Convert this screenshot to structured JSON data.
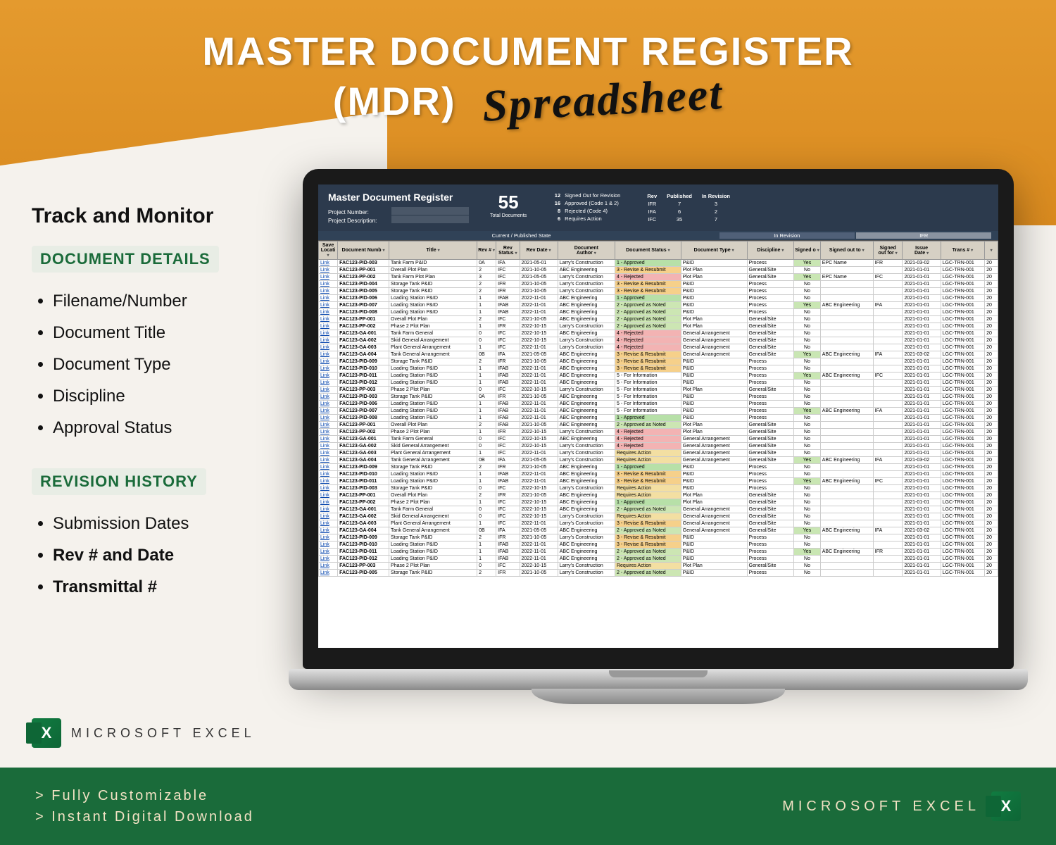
{
  "hero": {
    "line1": "MASTER DOCUMENT REGISTER",
    "line2": "(MDR)",
    "script": "Spreadsheet"
  },
  "sidebar": {
    "heading": "Track and Monitor",
    "section1": {
      "title": "DOCUMENT DETAILS",
      "items": [
        "Filename/Number",
        "Document Title",
        "Document Type",
        "Discipline",
        "Approval Status"
      ]
    },
    "section2": {
      "title": "REVISION HISTORY",
      "items": [
        "Submission Dates",
        "Rev # and Date",
        "Transmittal #"
      ],
      "bold": [
        1,
        2
      ]
    }
  },
  "excel_label": "MICROSOFT EXCEL",
  "footer": {
    "lines": [
      "> Fully Customizable",
      "> Instant Digital Download"
    ],
    "right": "MICROSOFT EXCEL"
  },
  "dash": {
    "title": "Master Document Register",
    "meta": [
      {
        "label": "Project Number:"
      },
      {
        "label": "Project Description:"
      }
    ],
    "total": {
      "value": "55",
      "sub": "Total\nDocuments"
    },
    "legend": [
      [
        "12",
        "Signed Out for Revision"
      ],
      [
        "16",
        "Approved (Code 1 & 2)"
      ],
      [
        "8",
        "Rejected (Code 4)"
      ],
      [
        "6",
        "Requires Action"
      ]
    ],
    "revtbl": {
      "cols": [
        "Rev",
        "Published",
        "In Revision"
      ],
      "rows": [
        [
          "IFR",
          "7",
          "3"
        ],
        [
          "IFA",
          "6",
          "2"
        ],
        [
          "IFC",
          "35",
          "7"
        ]
      ]
    }
  },
  "band_center": "Current / Published State",
  "band_right": [
    "In Revision",
    "IFR"
  ],
  "cols": [
    "Save\nLocati",
    "Document Numb",
    "Title",
    "Rev #",
    "Rev\nStatus",
    "Rev Date",
    "Document\nAuthor",
    "Document Status",
    "Document Type",
    "Discipline",
    "Signed o",
    "Signed out to",
    "Signed\nout for",
    "Issue\nDate",
    "Trans #",
    ""
  ],
  "status_class": {
    "1 - Approved": "st-approved",
    "2 - Approved as Noted": "st-appnoted",
    "3 - Revise & Resubmit": "st-resubmit",
    "4 - Rejected": "st-rejected",
    "5 - For Information": "st-info",
    "Requires Action": "st-action"
  },
  "rows": [
    [
      "Link",
      "FAC123-PID-003",
      "Tank Farm P&ID",
      "0A",
      "IFA",
      "2021-05-01",
      "Larry's Construction",
      "1 - Approved",
      "P&ID",
      "Process",
      "Yes",
      "EPC Name",
      "IFR",
      "2021-03-02",
      "LGC-TRN-001",
      "20"
    ],
    [
      "Link",
      "FAC123-PP-001",
      "Overall Plot Plan",
      "2",
      "IFC",
      "2021-10-05",
      "ABC Engineering",
      "3 - Revise & Resubmit",
      "Plot Plan",
      "General/Site",
      "No",
      "",
      "",
      "2021-01-01",
      "LGC-TRN-001",
      "20"
    ],
    [
      "Link",
      "FAC123-PP-002",
      "Tank Farm Plot Plan",
      "3",
      "IFC",
      "2021-05-05",
      "Larry's Construction",
      "4 - Rejected",
      "Plot Plan",
      "General/Site",
      "Yes",
      "EPC Name",
      "IFC",
      "2021-01-01",
      "LGC-TRN-001",
      "20"
    ],
    [
      "Link",
      "FAC123-PID-004",
      "Storage Tank P&ID",
      "2",
      "IFR",
      "2021-10-05",
      "Larry's Construction",
      "3 - Revise & Resubmit",
      "P&ID",
      "Process",
      "No",
      "",
      "",
      "2021-01-01",
      "LGC-TRN-001",
      "20"
    ],
    [
      "Link",
      "FAC123-PID-005",
      "Storage Tank P&ID",
      "2",
      "IFR",
      "2021-10-05",
      "Larry's Construction",
      "3 - Revise & Resubmit",
      "P&ID",
      "Process",
      "No",
      "",
      "",
      "2021-01-01",
      "LGC-TRN-001",
      "20"
    ],
    [
      "Link",
      "FAC123-PID-006",
      "Loading Station P&ID",
      "1",
      "IFAB",
      "2022-11-01",
      "ABC Engineering",
      "1 - Approved",
      "P&ID",
      "Process",
      "No",
      "",
      "",
      "2021-01-01",
      "LGC-TRN-001",
      "20"
    ],
    [
      "Link",
      "FAC123-PID-007",
      "Loading Station P&ID",
      "1",
      "IFAB",
      "2022-11-01",
      "ABC Engineering",
      "2 - Approved as Noted",
      "P&ID",
      "Process",
      "Yes",
      "ABC Engineering",
      "IFA",
      "2021-01-01",
      "LGC-TRN-001",
      "20"
    ],
    [
      "Link",
      "FAC123-PID-008",
      "Loading Station P&ID",
      "1",
      "IFAB",
      "2022-11-01",
      "ABC Engineering",
      "2 - Approved as Noted",
      "P&ID",
      "Process",
      "No",
      "",
      "",
      "2021-01-01",
      "LGC-TRN-001",
      "20"
    ],
    [
      "Link",
      "FAC123-PP-001",
      "Overall Plot Plan",
      "2",
      "IFC",
      "2021-10-05",
      "ABC Engineering",
      "2 - Approved as Noted",
      "Plot Plan",
      "General/Site",
      "No",
      "",
      "",
      "2021-01-01",
      "LGC-TRN-001",
      "20"
    ],
    [
      "Link",
      "FAC123-PP-002",
      "Phase 2 Plot Plan",
      "1",
      "IFR",
      "2022-10-15",
      "Larry's Construction",
      "2 - Approved as Noted",
      "Plot Plan",
      "General/Site",
      "No",
      "",
      "",
      "2021-01-01",
      "LGC-TRN-001",
      "20"
    ],
    [
      "Link",
      "FAC123-GA-001",
      "Tank Farm General",
      "0",
      "IFC",
      "2022-10-15",
      "ABC Engineering",
      "4 - Rejected",
      "General Arrangement",
      "General/Site",
      "No",
      "",
      "",
      "2021-01-01",
      "LGC-TRN-001",
      "20"
    ],
    [
      "Link",
      "FAC123-GA-002",
      "Skid General Arrangement",
      "0",
      "IFC",
      "2022-10-15",
      "Larry's Construction",
      "4 - Rejected",
      "General Arrangement",
      "General/Site",
      "No",
      "",
      "",
      "2021-01-01",
      "LGC-TRN-001",
      "20"
    ],
    [
      "Link",
      "FAC123-GA-003",
      "Plant General Arrangement",
      "1",
      "IFC",
      "2022-11-01",
      "Larry's Construction",
      "4 - Rejected",
      "General Arrangement",
      "General/Site",
      "No",
      "",
      "",
      "2021-01-01",
      "LGC-TRN-001",
      "20"
    ],
    [
      "Link",
      "FAC123-GA-004",
      "Tank General Arrangement",
      "0B",
      "IFA",
      "2021-05-05",
      "ABC Engineering",
      "3 - Revise & Resubmit",
      "General Arrangement",
      "General/Site",
      "Yes",
      "ABC Engineering",
      "IFA",
      "2021-03-02",
      "LGC-TRN-001",
      "20"
    ],
    [
      "Link",
      "FAC123-PID-009",
      "Storage Tank P&ID",
      "2",
      "IFR",
      "2021-10-05",
      "ABC Engineering",
      "3 - Revise & Resubmit",
      "P&ID",
      "Process",
      "No",
      "",
      "",
      "2021-01-01",
      "LGC-TRN-001",
      "20"
    ],
    [
      "Link",
      "FAC123-PID-010",
      "Loading Station P&ID",
      "1",
      "IFAB",
      "2022-11-01",
      "ABC Engineering",
      "3 - Revise & Resubmit",
      "P&ID",
      "Process",
      "No",
      "",
      "",
      "2021-01-01",
      "LGC-TRN-001",
      "20"
    ],
    [
      "Link",
      "FAC123-PID-011",
      "Loading Station P&ID",
      "1",
      "IFAB",
      "2022-11-01",
      "ABC Engineering",
      "5 - For Information",
      "P&ID",
      "Process",
      "Yes",
      "ABC Engineering",
      "IFC",
      "2021-01-01",
      "LGC-TRN-001",
      "20"
    ],
    [
      "Link",
      "FAC123-PID-012",
      "Loading Station P&ID",
      "1",
      "IFAB",
      "2022-11-01",
      "ABC Engineering",
      "5 - For Information",
      "P&ID",
      "Process",
      "No",
      "",
      "",
      "2021-01-01",
      "LGC-TRN-001",
      "20"
    ],
    [
      "Link",
      "FAC123-PP-003",
      "Phase 2 Plot Plan",
      "0",
      "IFC",
      "2022-10-15",
      "Larry's Construction",
      "5 - For Information",
      "Plot Plan",
      "General/Site",
      "No",
      "",
      "",
      "2021-01-01",
      "LGC-TRN-001",
      "20"
    ],
    [
      "Link",
      "FAC123-PID-003",
      "Storage Tank P&ID",
      "0A",
      "IFR",
      "2021-10-05",
      "ABC Engineering",
      "5 - For Information",
      "P&ID",
      "Process",
      "No",
      "",
      "",
      "2021-01-01",
      "LGC-TRN-001",
      "20"
    ],
    [
      "Link",
      "FAC123-PID-006",
      "Loading Station P&ID",
      "1",
      "IFAB",
      "2022-11-01",
      "ABC Engineering",
      "5 - For Information",
      "P&ID",
      "Process",
      "No",
      "",
      "",
      "2021-01-01",
      "LGC-TRN-001",
      "20"
    ],
    [
      "Link",
      "FAC123-PID-007",
      "Loading Station P&ID",
      "1",
      "IFAB",
      "2022-11-01",
      "ABC Engineering",
      "5 - For Information",
      "P&ID",
      "Process",
      "Yes",
      "ABC Engineering",
      "IFA",
      "2021-01-01",
      "LGC-TRN-001",
      "20"
    ],
    [
      "Link",
      "FAC123-PID-008",
      "Loading Station P&ID",
      "1",
      "IFAB",
      "2022-11-01",
      "ABC Engineering",
      "1 - Approved",
      "P&ID",
      "Process",
      "No",
      "",
      "",
      "2021-01-01",
      "LGC-TRN-001",
      "20"
    ],
    [
      "Link",
      "FAC123-PP-001",
      "Overall Plot Plan",
      "2",
      "IFAB",
      "2021-10-05",
      "ABC Engineering",
      "2 - Approved as Noted",
      "Plot Plan",
      "General/Site",
      "No",
      "",
      "",
      "2021-01-01",
      "LGC-TRN-001",
      "20"
    ],
    [
      "Link",
      "FAC123-PP-002",
      "Phase 2 Plot Plan",
      "1",
      "IFR",
      "2022-10-15",
      "Larry's Construction",
      "4 - Rejected",
      "Plot Plan",
      "General/Site",
      "No",
      "",
      "",
      "2021-01-01",
      "LGC-TRN-001",
      "20"
    ],
    [
      "Link",
      "FAC123-GA-001",
      "Tank Farm General",
      "0",
      "IFC",
      "2022-10-15",
      "ABC Engineering",
      "4 - Rejected",
      "General Arrangement",
      "General/Site",
      "No",
      "",
      "",
      "2021-01-01",
      "LGC-TRN-001",
      "20"
    ],
    [
      "Link",
      "FAC123-GA-002",
      "Skid General Arrangement",
      "0",
      "IFC",
      "2022-10-15",
      "Larry's Construction",
      "4 - Rejected",
      "General Arrangement",
      "General/Site",
      "No",
      "",
      "",
      "2021-01-01",
      "LGC-TRN-001",
      "20"
    ],
    [
      "Link",
      "FAC123-GA-003",
      "Plant General Arrangement",
      "1",
      "IFC",
      "2022-11-01",
      "Larry's Construction",
      "Requires Action",
      "General Arrangement",
      "General/Site",
      "No",
      "",
      "",
      "2021-01-01",
      "LGC-TRN-001",
      "20"
    ],
    [
      "Link",
      "FAC123-GA-004",
      "Tank General Arrangement",
      "0B",
      "IFA",
      "2021-05-05",
      "Larry's Construction",
      "Requires Action",
      "General Arrangement",
      "General/Site",
      "Yes",
      "ABC Engineering",
      "IFA",
      "2021-03-02",
      "LGC-TRN-001",
      "20"
    ],
    [
      "Link",
      "FAC123-PID-009",
      "Storage Tank P&ID",
      "2",
      "IFR",
      "2021-10-05",
      "ABC Engineering",
      "1 - Approved",
      "P&ID",
      "Process",
      "No",
      "",
      "",
      "2021-01-01",
      "LGC-TRN-001",
      "20"
    ],
    [
      "Link",
      "FAC123-PID-010",
      "Loading Station P&ID",
      "1",
      "IFAB",
      "2022-11-01",
      "ABC Engineering",
      "3 - Revise & Resubmit",
      "P&ID",
      "Process",
      "No",
      "",
      "",
      "2021-01-01",
      "LGC-TRN-001",
      "20"
    ],
    [
      "Link",
      "FAC123-PID-011",
      "Loading Station P&ID",
      "1",
      "IFAB",
      "2022-11-01",
      "ABC Engineering",
      "3 - Revise & Resubmit",
      "P&ID",
      "Process",
      "Yes",
      "ABC Engineering",
      "IFC",
      "2021-01-01",
      "LGC-TRN-001",
      "20"
    ],
    [
      "Link",
      "FAC123-PID-003",
      "Storage Tank P&ID",
      "0",
      "IFC",
      "2022-10-15",
      "Larry's Construction",
      "Requires Action",
      "P&ID",
      "Process",
      "No",
      "",
      "",
      "2021-01-01",
      "LGC-TRN-001",
      "20"
    ],
    [
      "Link",
      "FAC123-PP-001",
      "Overall Plot Plan",
      "2",
      "IFR",
      "2021-10-05",
      "ABC Engineering",
      "Requires Action",
      "Plot Plan",
      "General/Site",
      "No",
      "",
      "",
      "2021-01-01",
      "LGC-TRN-001",
      "20"
    ],
    [
      "Link",
      "FAC123-PP-002",
      "Phase 2 Plot Plan",
      "1",
      "IFC",
      "2022-10-15",
      "ABC Engineering",
      "1 - Approved",
      "Plot Plan",
      "General/Site",
      "No",
      "",
      "",
      "2021-01-01",
      "LGC-TRN-001",
      "20"
    ],
    [
      "Link",
      "FAC123-GA-001",
      "Tank Farm General",
      "0",
      "IFC",
      "2022-10-15",
      "ABC Engineering",
      "2 - Approved as Noted",
      "General Arrangement",
      "General/Site",
      "No",
      "",
      "",
      "2021-01-01",
      "LGC-TRN-001",
      "20"
    ],
    [
      "Link",
      "FAC123-GA-002",
      "Skid General Arrangement",
      "0",
      "IFC",
      "2022-10-15",
      "Larry's Construction",
      "Requires Action",
      "General Arrangement",
      "General/Site",
      "No",
      "",
      "",
      "2021-01-01",
      "LGC-TRN-001",
      "20"
    ],
    [
      "Link",
      "FAC123-GA-003",
      "Plant General Arrangement",
      "1",
      "IFC",
      "2022-11-01",
      "Larry's Construction",
      "3 - Revise & Resubmit",
      "General Arrangement",
      "General/Site",
      "No",
      "",
      "",
      "2021-01-01",
      "LGC-TRN-001",
      "20"
    ],
    [
      "Link",
      "FAC123-GA-004",
      "Tank General Arrangement",
      "0B",
      "IFA",
      "2021-05-05",
      "ABC Engineering",
      "2 - Approved as Noted",
      "General Arrangement",
      "General/Site",
      "Yes",
      "ABC Engineering",
      "IFA",
      "2021-03-02",
      "LGC-TRN-001",
      "20"
    ],
    [
      "Link",
      "FAC123-PID-009",
      "Storage Tank P&ID",
      "2",
      "IFR",
      "2021-10-05",
      "Larry's Construction",
      "3 - Revise & Resubmit",
      "P&ID",
      "Process",
      "No",
      "",
      "",
      "2021-01-01",
      "LGC-TRN-001",
      "20"
    ],
    [
      "Link",
      "FAC123-PID-010",
      "Loading Station P&ID",
      "1",
      "IFAB",
      "2022-11-01",
      "ABC Engineering",
      "3 - Revise & Resubmit",
      "P&ID",
      "Process",
      "No",
      "",
      "",
      "2021-01-01",
      "LGC-TRN-001",
      "20"
    ],
    [
      "Link",
      "FAC123-PID-011",
      "Loading Station P&ID",
      "1",
      "IFAB",
      "2022-11-01",
      "ABC Engineering",
      "2 - Approved as Noted",
      "P&ID",
      "Process",
      "Yes",
      "ABC Engineering",
      "IFR",
      "2021-01-01",
      "LGC-TRN-001",
      "20"
    ],
    [
      "Link",
      "FAC123-PID-012",
      "Loading Station P&ID",
      "1",
      "IFAB",
      "2022-11-01",
      "ABC Engineering",
      "2 - Approved as Noted",
      "P&ID",
      "Process",
      "No",
      "",
      "",
      "2021-01-01",
      "LGC-TRN-001",
      "20"
    ],
    [
      "Link",
      "FAC123-PP-003",
      "Phase 2 Plot Plan",
      "0",
      "IFC",
      "2022-10-15",
      "Larry's Construction",
      "Requires Action",
      "Plot Plan",
      "General/Site",
      "No",
      "",
      "",
      "2021-01-01",
      "LGC-TRN-001",
      "20"
    ],
    [
      "Link",
      "FAC123-PID-005",
      "Storage Tank P&ID",
      "2",
      "IFR",
      "2021-10-05",
      "Larry's Construction",
      "2 - Approved as Noted",
      "P&ID",
      "Process",
      "No",
      "",
      "",
      "2021-01-01",
      "LGC-TRN-001",
      "20"
    ]
  ]
}
